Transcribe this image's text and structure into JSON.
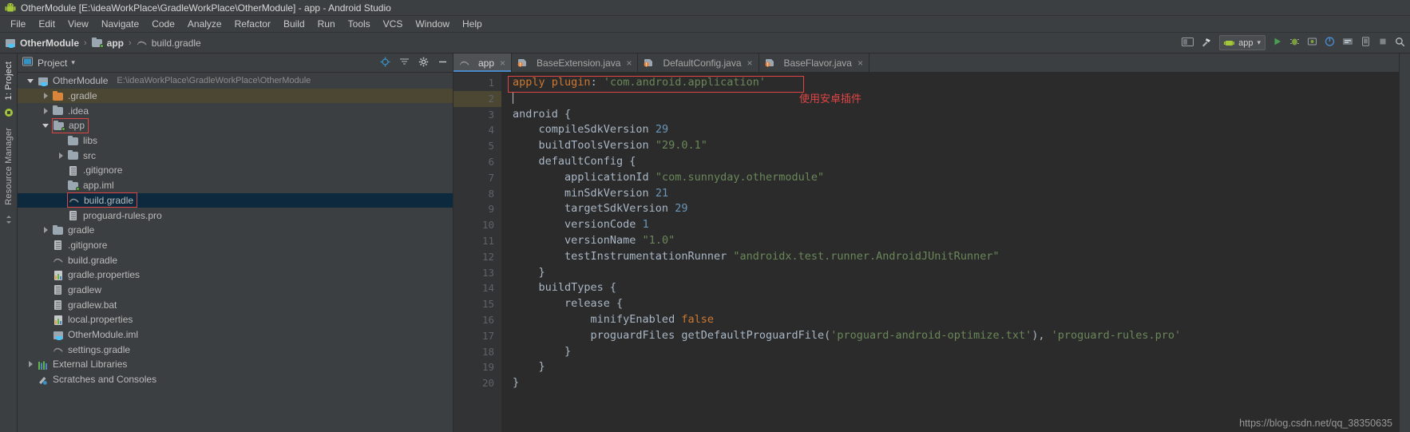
{
  "window": {
    "title": "OtherModule [E:\\ideaWorkPlace\\GradleWorkPlace\\OtherModule] - app - Android Studio",
    "app_icon": "android-robot-icon"
  },
  "menubar": {
    "items": [
      {
        "label": "File"
      },
      {
        "label": "Edit"
      },
      {
        "label": "View"
      },
      {
        "label": "Navigate"
      },
      {
        "label": "Code"
      },
      {
        "label": "Analyze"
      },
      {
        "label": "Refactor"
      },
      {
        "label": "Build"
      },
      {
        "label": "Run"
      },
      {
        "label": "Tools"
      },
      {
        "label": "VCS"
      },
      {
        "label": "Window"
      },
      {
        "label": "Help"
      }
    ]
  },
  "toolbar": {
    "breadcrumbs": [
      {
        "label": "OtherModule",
        "icon": "module-icon"
      },
      {
        "label": "app",
        "icon": "module-folder-icon"
      },
      {
        "label": "build.gradle",
        "icon": "gradle-icon"
      }
    ],
    "separator": "›",
    "run_config": {
      "label": "app",
      "icon": "android-module-icon",
      "chevron": "▾"
    },
    "right_icons": [
      "layout-inspector-icon",
      "build-hammer-icon",
      "run-icon",
      "debug-icon",
      "profile-icon",
      "attach-debugger-icon",
      "sdk-manager-icon",
      "avd-manager-icon",
      "stop-icon",
      "search-icon"
    ]
  },
  "left_strip": {
    "items": [
      {
        "label": "1: Project",
        "active": true
      },
      {
        "label": "Resource Manager",
        "active": false
      }
    ]
  },
  "project_panel": {
    "title": "Project",
    "chevron": "▾",
    "header_icons": [
      "locate-icon",
      "collapse-all-icon",
      "settings-gear-icon",
      "hide-icon"
    ],
    "tree": [
      {
        "depth": 0,
        "label": "OtherModule",
        "path": "E:\\ideaWorkPlace\\GradleWorkPlace\\OtherModule",
        "icon": "project-module-icon",
        "arrow": "down",
        "state": "normal"
      },
      {
        "depth": 1,
        "label": ".gradle",
        "icon": "folder-orange-icon",
        "arrow": "right",
        "state": "highlight"
      },
      {
        "depth": 1,
        "label": ".idea",
        "icon": "folder-icon",
        "arrow": "right",
        "state": "normal"
      },
      {
        "depth": 1,
        "label": "app",
        "icon": "module-folder-icon",
        "arrow": "down",
        "state": "normal",
        "boxed": true
      },
      {
        "depth": 2,
        "label": "libs",
        "icon": "folder-icon",
        "arrow": "none",
        "state": "normal"
      },
      {
        "depth": 2,
        "label": "src",
        "icon": "folder-icon",
        "arrow": "right",
        "state": "normal"
      },
      {
        "depth": 2,
        "label": ".gitignore",
        "icon": "file-icon",
        "arrow": "none",
        "state": "normal"
      },
      {
        "depth": 2,
        "label": "app.iml",
        "icon": "module-folder-icon",
        "arrow": "none",
        "state": "normal"
      },
      {
        "depth": 2,
        "label": "build.gradle",
        "icon": "gradle-icon",
        "arrow": "none",
        "state": "selected",
        "boxed": true
      },
      {
        "depth": 2,
        "label": "proguard-rules.pro",
        "icon": "file-icon",
        "arrow": "none",
        "state": "normal"
      },
      {
        "depth": 1,
        "label": "gradle",
        "icon": "folder-icon",
        "arrow": "right",
        "state": "normal"
      },
      {
        "depth": 1,
        "label": ".gitignore",
        "icon": "file-icon",
        "arrow": "none",
        "state": "normal"
      },
      {
        "depth": 1,
        "label": "build.gradle",
        "icon": "gradle-icon",
        "arrow": "none",
        "state": "normal"
      },
      {
        "depth": 1,
        "label": "gradle.properties",
        "icon": "properties-icon",
        "arrow": "none",
        "state": "normal"
      },
      {
        "depth": 1,
        "label": "gradlew",
        "icon": "file-icon",
        "arrow": "none",
        "state": "normal"
      },
      {
        "depth": 1,
        "label": "gradlew.bat",
        "icon": "file-icon",
        "arrow": "none",
        "state": "normal"
      },
      {
        "depth": 1,
        "label": "local.properties",
        "icon": "properties-icon",
        "arrow": "none",
        "state": "normal"
      },
      {
        "depth": 1,
        "label": "OtherModule.iml",
        "icon": "iml-icon",
        "arrow": "none",
        "state": "normal"
      },
      {
        "depth": 1,
        "label": "settings.gradle",
        "icon": "gradle-icon",
        "arrow": "none",
        "state": "normal"
      },
      {
        "depth": 0,
        "label": "External Libraries",
        "icon": "libraries-icon",
        "arrow": "right",
        "state": "normal"
      },
      {
        "depth": 0,
        "label": "Scratches and Consoles",
        "icon": "scratches-icon",
        "arrow": "none",
        "state": "normal"
      }
    ]
  },
  "editor": {
    "tabs": [
      {
        "label": "app",
        "icon": "gradle-icon",
        "active": true,
        "close": "×"
      },
      {
        "label": "BaseExtension.java",
        "icon": "java-class-icon",
        "active": false,
        "close": "×"
      },
      {
        "label": "DefaultConfig.java",
        "icon": "java-class-icon",
        "active": false,
        "close": "×"
      },
      {
        "label": "BaseFlavor.java",
        "icon": "java-class-icon",
        "active": false,
        "close": "×"
      }
    ],
    "line_numbers": [
      "1",
      "2",
      "3",
      "4",
      "5",
      "6",
      "7",
      "8",
      "9",
      "10",
      "11",
      "12",
      "13",
      "14",
      "15",
      "16",
      "17",
      "18",
      "19",
      "20"
    ],
    "lines": [
      [
        {
          "t": "apply ",
          "c": "kw"
        },
        {
          "t": "plugin",
          "c": "kw"
        },
        {
          "t": ": ",
          "c": "pln"
        },
        {
          "t": "'com.android.application'",
          "c": "str"
        }
      ],
      [
        {
          "t": "",
          "c": "pln"
        }
      ],
      [
        {
          "t": "android {",
          "c": "pln"
        }
      ],
      [
        {
          "t": "    compileSdkVersion ",
          "c": "pln"
        },
        {
          "t": "29",
          "c": "num"
        }
      ],
      [
        {
          "t": "    buildToolsVersion ",
          "c": "pln"
        },
        {
          "t": "\"29.0.1\"",
          "c": "str"
        }
      ],
      [
        {
          "t": "    defaultConfig {",
          "c": "pln"
        }
      ],
      [
        {
          "t": "        applicationId ",
          "c": "pln"
        },
        {
          "t": "\"com.sunnyday.othermodule\"",
          "c": "str"
        }
      ],
      [
        {
          "t": "        minSdkVersion ",
          "c": "pln"
        },
        {
          "t": "21",
          "c": "num"
        }
      ],
      [
        {
          "t": "        targetSdkVersion ",
          "c": "pln"
        },
        {
          "t": "29",
          "c": "num"
        }
      ],
      [
        {
          "t": "        versionCode ",
          "c": "pln"
        },
        {
          "t": "1",
          "c": "num"
        }
      ],
      [
        {
          "t": "        versionName ",
          "c": "pln"
        },
        {
          "t": "\"1.0\"",
          "c": "str"
        }
      ],
      [
        {
          "t": "        testInstrumentationRunner ",
          "c": "pln"
        },
        {
          "t": "\"androidx.test.runner.AndroidJUnitRunner\"",
          "c": "str"
        }
      ],
      [
        {
          "t": "    }",
          "c": "pln"
        }
      ],
      [
        {
          "t": "    buildTypes {",
          "c": "pln"
        }
      ],
      [
        {
          "t": "        release {",
          "c": "pln"
        }
      ],
      [
        {
          "t": "            minifyEnabled ",
          "c": "pln"
        },
        {
          "t": "false",
          "c": "kw"
        }
      ],
      [
        {
          "t": "            proguardFiles getDefaultProguardFile(",
          "c": "pln"
        },
        {
          "t": "'proguard-android-optimize.txt'",
          "c": "str"
        },
        {
          "t": "), ",
          "c": "pln"
        },
        {
          "t": "'proguard-rules.pro'",
          "c": "str"
        }
      ],
      [
        {
          "t": "        }",
          "c": "pln"
        }
      ],
      [
        {
          "t": "    }",
          "c": "pln"
        }
      ],
      [
        {
          "t": "}",
          "c": "pln"
        }
      ]
    ]
  },
  "annotations": {
    "code_note": "使用安卓插件",
    "box_color": "#e04545"
  },
  "watermark": {
    "text": "https://blog.csdn.net/qq_38350635"
  },
  "colors": {
    "accent": "#4a88c7",
    "selection": "#0d293e",
    "highlight": "#4b4733",
    "editor_bg": "#2b2b2b",
    "panel_bg": "#3c3f41",
    "string": "#6a8759",
    "keyword": "#cc7832",
    "number": "#6897bb",
    "plain": "#a9b7c6",
    "annotation_red": "#e04545"
  }
}
